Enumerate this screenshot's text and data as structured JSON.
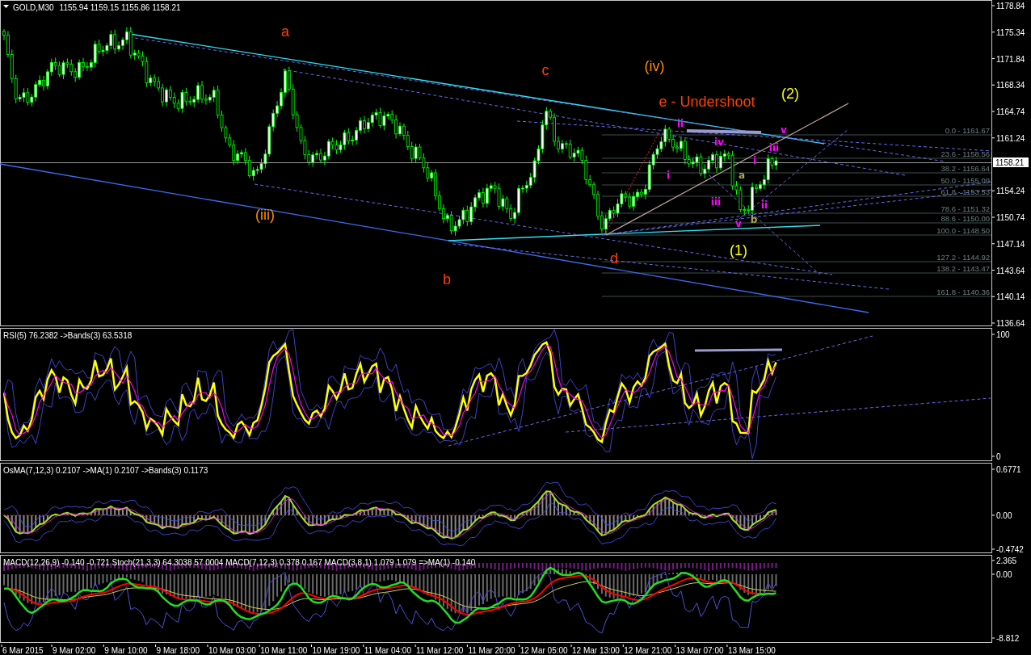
{
  "chart": {
    "symbol": "GOLD,M30",
    "ohlc": "1155.94 1159.15 1155.86 1158.21"
  },
  "main_pane": {
    "price_axis": [
      "1178.84",
      "1175.34",
      "1171.84",
      "1168.34",
      "1164.74",
      "1161.24",
      "1154.24",
      "1150.74",
      "1147.14",
      "1143.64",
      "1140.14",
      "1136.64"
    ],
    "current_price": "1158.21",
    "wave_labels": [
      {
        "text": "a",
        "kind": "major",
        "color": "#ff4000"
      },
      {
        "text": "(iii)",
        "kind": "major",
        "color": "#ff8c00"
      },
      {
        "text": "b",
        "kind": "major",
        "color": "#ff4000"
      },
      {
        "text": "c",
        "kind": "major",
        "color": "#ff4000"
      },
      {
        "text": "(iv)",
        "kind": "major",
        "color": "#ff8c00"
      },
      {
        "text": "e - Undershoot",
        "kind": "major",
        "color": "#ff4000"
      },
      {
        "text": "(2)",
        "kind": "major",
        "color": "#ffff00"
      },
      {
        "text": "d",
        "kind": "major",
        "color": "#ff4000"
      },
      {
        "text": "(1)",
        "kind": "major",
        "color": "#ffff00"
      },
      {
        "text": "ii",
        "kind": "minor",
        "color": "#ff00ff"
      },
      {
        "text": "iv",
        "kind": "minor",
        "color": "#ff00ff"
      },
      {
        "text": "i",
        "kind": "minor",
        "color": "#ff00ff"
      },
      {
        "text": "iii",
        "kind": "minor",
        "color": "#ff00ff"
      },
      {
        "text": "v",
        "kind": "minor",
        "color": "#ff00ff"
      },
      {
        "text": "ii",
        "kind": "minor",
        "color": "#ff00ff"
      },
      {
        "text": "i",
        "kind": "minor",
        "color": "#ff00ff"
      },
      {
        "text": "iii",
        "kind": "minor",
        "color": "#ff00ff"
      },
      {
        "text": "v",
        "kind": "minor",
        "color": "#ff00ff"
      },
      {
        "text": "a",
        "kind": "minor",
        "color": "#a8a850"
      },
      {
        "text": "b",
        "kind": "minor",
        "color": "#a8a850"
      }
    ],
    "fib_levels": [
      {
        "label": "0.0 - 1161.67"
      },
      {
        "label": "23.6 - 1158.56"
      },
      {
        "label": "38.2 - 1156.64"
      },
      {
        "label": "50.0 - 1155.09"
      },
      {
        "label": "61.8 - 1153.53"
      },
      {
        "label": "78.6 - 1151.32"
      },
      {
        "label": "88.6 - 1150.00"
      },
      {
        "label": "100.0 - 1148.50"
      },
      {
        "label": "127.2 - 1144.92"
      },
      {
        "label": "138.2 - 1143.47"
      },
      {
        "label": "161.8 - 1140.36"
      }
    ]
  },
  "rsi_pane": {
    "legend": "RSI(5) 76.2382  ->Bands(3) 63.5318",
    "axis": [
      "100",
      "0"
    ]
  },
  "osma_pane": {
    "legend": "OsMA(7,12,3) 0.2107  ->MA(1) 0.2107  ->Bands(3) 0.1173",
    "axis": [
      "0.6771",
      "0.00",
      "-0.4742"
    ]
  },
  "macd_pane": {
    "legend": "MACD(12,26,9) -0.140 -0.721  Stoch(21,3,3) 64.3038 57.0004  MACD(7,12,3) 0.378 0.167  MACD(3,8,1) 1.079 1.079  =>MA(1) -0.140",
    "axis": [
      "2.365",
      "0.00",
      "-8.812"
    ]
  },
  "time_axis": [
    "6 Mar 2015",
    "9 Mar 02:00",
    "9 Mar 10:00",
    "9 Mar 18:00",
    "10 Mar 03:00",
    "10 Mar 11:00",
    "10 Mar 19:00",
    "11 Mar 04:00",
    "11 Mar 12:00",
    "11 Mar 20:00",
    "12 Mar 05:00",
    "12 Mar 13:00",
    "12 Mar 21:00",
    "13 Mar 07:00",
    "13 Mar 15:00"
  ]
}
